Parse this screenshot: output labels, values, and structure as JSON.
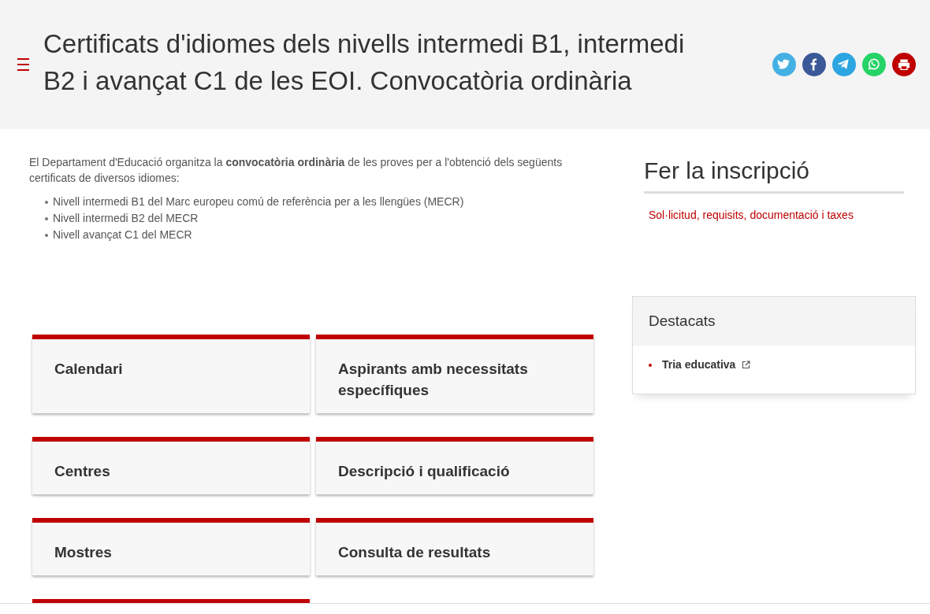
{
  "header": {
    "title": "Certificats d'idiomes dels nivells intermedi B1, intermedi B2 i avançat C1 de les EOI. Convocatòria ordinària",
    "share": [
      {
        "kind": "twitter",
        "color": "#45b0e3"
      },
      {
        "kind": "facebook",
        "color": "#3b5998"
      },
      {
        "kind": "telegram",
        "color": "#2ca5e0"
      },
      {
        "kind": "whatsapp",
        "color": "#25d366"
      },
      {
        "kind": "print",
        "color": "#c00000"
      }
    ]
  },
  "intro": {
    "text": "El Departament d'Educació organitza la **convocatòria ordinària** de les proves per a l'obtenció dels següents certificats de diversos idiomes:",
    "items": [
      "Nivell intermedi B1 del Marc europeu comú de referència per a les llengües (MECR)",
      "Nivell intermedi B2 del MECR",
      "Nivell avançat C1 del MECR"
    ]
  },
  "cards": [
    {
      "kind": "card",
      "title": "Calendari"
    },
    {
      "kind": "card",
      "title": "Aspirants amb necessitats específiques"
    },
    {
      "kind": "card",
      "title": "Centres"
    },
    {
      "kind": "card",
      "title": "Descripció i qualificació"
    },
    {
      "kind": "card",
      "title": "Mostres"
    },
    {
      "kind": "card",
      "title": "Consulta de resultats"
    },
    {
      "kind": "partial"
    }
  ],
  "inscripcio": {
    "title": "Fer la inscripció",
    "link": "Sol·licitud, requisits, documentació i taxes"
  },
  "destacats": {
    "title": "Destacats",
    "items": [
      {
        "label": "Tria educativa",
        "external": true
      }
    ]
  }
}
